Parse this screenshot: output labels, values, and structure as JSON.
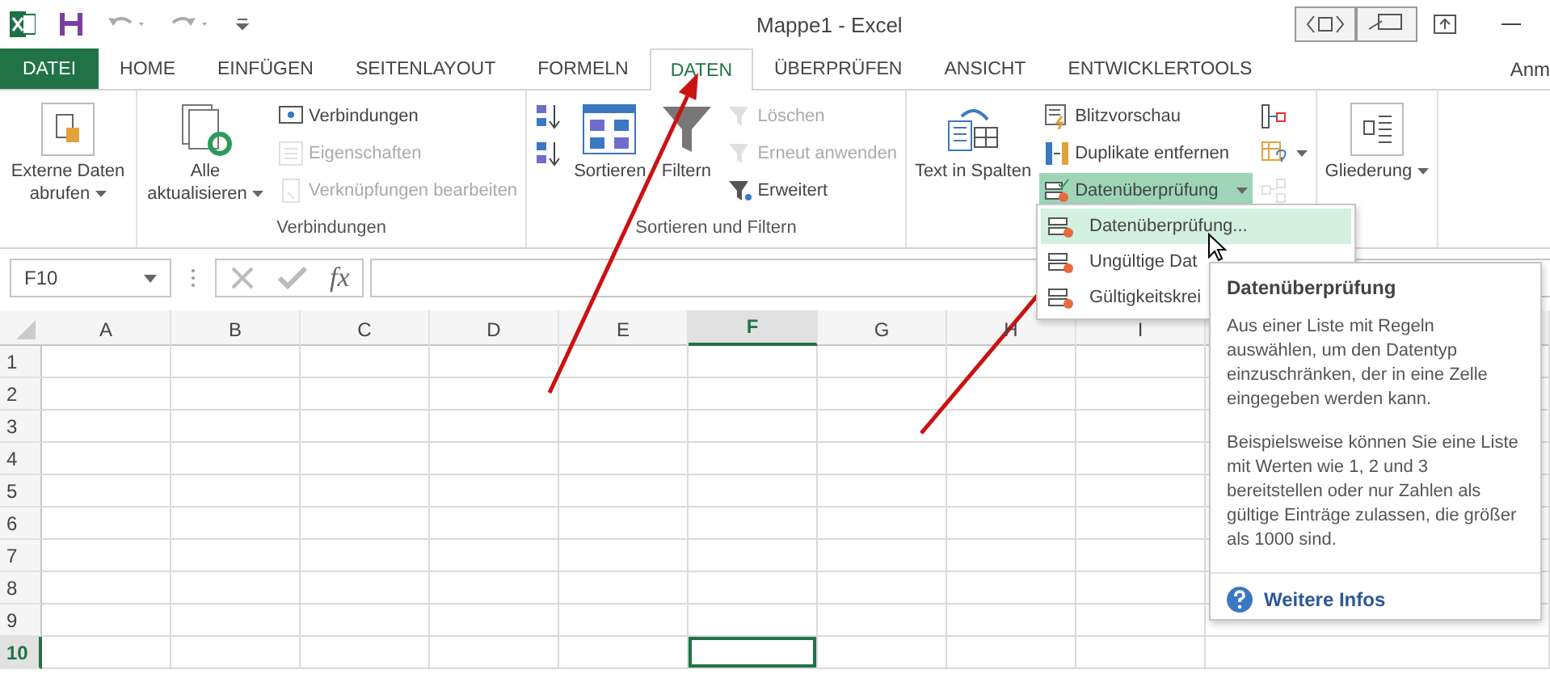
{
  "window": {
    "title": "Mappe1 - Excel"
  },
  "tabs": [
    {
      "label": "DATEI",
      "kind": "file",
      "selected": false
    },
    {
      "label": "HOME",
      "kind": "tab",
      "selected": false
    },
    {
      "label": "EINFÜGEN",
      "kind": "tab",
      "selected": false
    },
    {
      "label": "SEITENLAYOUT",
      "kind": "tab",
      "selected": false
    },
    {
      "label": "FORMELN",
      "kind": "tab",
      "selected": false
    },
    {
      "label": "DATEN",
      "kind": "tab",
      "selected": true
    },
    {
      "label": "ÜBERPRÜFEN",
      "kind": "tab",
      "selected": false
    },
    {
      "label": "ANSICHT",
      "kind": "tab",
      "selected": false
    },
    {
      "label": "ENTWICKLERTOOLS",
      "kind": "tab",
      "selected": false
    }
  ],
  "account": "Anm",
  "ribbon": {
    "groups": [
      {
        "controls": [
          {
            "kind": "large",
            "label": "Externe Daten abrufen",
            "dropdown": true,
            "disabled": false,
            "expanded": false
          }
        ]
      },
      {
        "label": "Verbindungen",
        "controls": [
          {
            "kind": "large",
            "label": "Alle aktualisieren",
            "dropdown": true,
            "disabled": false,
            "expanded": false
          },
          {
            "kind": "stack",
            "items": [
              {
                "kind": "small",
                "label": "Verbindungen",
                "dropdown": false,
                "disabled": false,
                "expanded": false
              },
              {
                "kind": "small",
                "label": "Eigenschaften",
                "dropdown": false,
                "disabled": true,
                "expanded": false
              },
              {
                "kind": "small",
                "label": "Verknüpfungen bearbeiten",
                "dropdown": false,
                "disabled": true,
                "expanded": false
              }
            ]
          }
        ]
      },
      {
        "label": "Sortieren und Filtern",
        "controls": [
          {
            "kind": "stack",
            "items": [
              {
                "kind": "icon",
                "dropdown": false,
                "disabled": false,
                "expanded": false
              },
              {
                "kind": "icon",
                "dropdown": false,
                "disabled": false,
                "expanded": false
              }
            ]
          },
          {
            "kind": "large",
            "label": "Sortieren",
            "dropdown": false,
            "disabled": false,
            "expanded": false
          },
          {
            "kind": "large",
            "label": "Filtern",
            "dropdown": false,
            "disabled": false,
            "expanded": false
          },
          {
            "kind": "stack",
            "items": [
              {
                "kind": "small",
                "label": "Löschen",
                "dropdown": false,
                "disabled": true,
                "expanded": false
              },
              {
                "kind": "small",
                "label": "Erneut anwenden",
                "dropdown": false,
                "disabled": true,
                "expanded": false
              },
              {
                "kind": "small",
                "label": "Erweitert",
                "dropdown": false,
                "disabled": false,
                "expanded": false
              }
            ]
          }
        ]
      },
      {
        "controls": [
          {
            "kind": "large",
            "label": "Text in Spalten",
            "dropdown": false,
            "disabled": false,
            "expanded": false
          },
          {
            "kind": "stack",
            "items": [
              {
                "kind": "small",
                "label": "Blitzvorschau",
                "dropdown": false,
                "disabled": false,
                "expanded": false
              },
              {
                "kind": "small",
                "label": "Duplikate entfernen",
                "dropdown": false,
                "disabled": false,
                "expanded": false
              },
              {
                "kind": "small",
                "label": "Datenüberprüfung",
                "dropdown": true,
                "disabled": false,
                "expanded": true
              }
            ]
          },
          {
            "kind": "stack",
            "items": [
              {
                "kind": "icon",
                "dropdown": false,
                "disabled": false,
                "expanded": false
              },
              {
                "kind": "icon",
                "dropdown": true,
                "disabled": false,
                "expanded": false
              },
              {
                "kind": "icon",
                "dropdown": false,
                "disabled": true,
                "expanded": false
              }
            ]
          }
        ]
      },
      {
        "controls": [
          {
            "kind": "large",
            "label": "Gliederung",
            "dropdown": true,
            "disabled": false,
            "expanded": false
          }
        ]
      }
    ]
  },
  "formula_bar": {
    "name_box": "F10",
    "function_button": "fx"
  },
  "sheet": {
    "columns": [
      {
        "label": "A",
        "selected": false
      },
      {
        "label": "B",
        "selected": false
      },
      {
        "label": "C",
        "selected": false
      },
      {
        "label": "D",
        "selected": false
      },
      {
        "label": "E",
        "selected": false
      },
      {
        "label": "F",
        "selected": true
      },
      {
        "label": "G",
        "selected": false
      },
      {
        "label": "H",
        "selected": false
      },
      {
        "label": "I",
        "selected": false
      }
    ],
    "rows": [
      {
        "label": "1",
        "selected": false
      },
      {
        "label": "2",
        "selected": false
      },
      {
        "label": "3",
        "selected": false
      },
      {
        "label": "4",
        "selected": false
      },
      {
        "label": "5",
        "selected": false
      },
      {
        "label": "6",
        "selected": false
      },
      {
        "label": "7",
        "selected": false
      },
      {
        "label": "8",
        "selected": false
      },
      {
        "label": "9",
        "selected": false
      },
      {
        "label": "10",
        "selected": true
      }
    ]
  },
  "menu": {
    "items": [
      {
        "label": "Datenüberprüfung...",
        "selected": true
      },
      {
        "label": "Ungültige Dat",
        "selected": false
      },
      {
        "label": "Gültigkeitskrei",
        "selected": false
      }
    ]
  },
  "tooltip": {
    "title": "Datenüberprüfung",
    "paragraphs": [
      "Aus einer Liste mit Regeln auswählen, um den Datentyp einzuschränken, der in eine Zelle eingegeben werden kann.",
      "Beispielsweise können Sie eine Liste mit Werten wie 1, 2 und 3 bereitstellen oder nur Zahlen als gültige Einträge zulassen, die größer als 1000 sind."
    ],
    "link": "Weitere Infos"
  }
}
